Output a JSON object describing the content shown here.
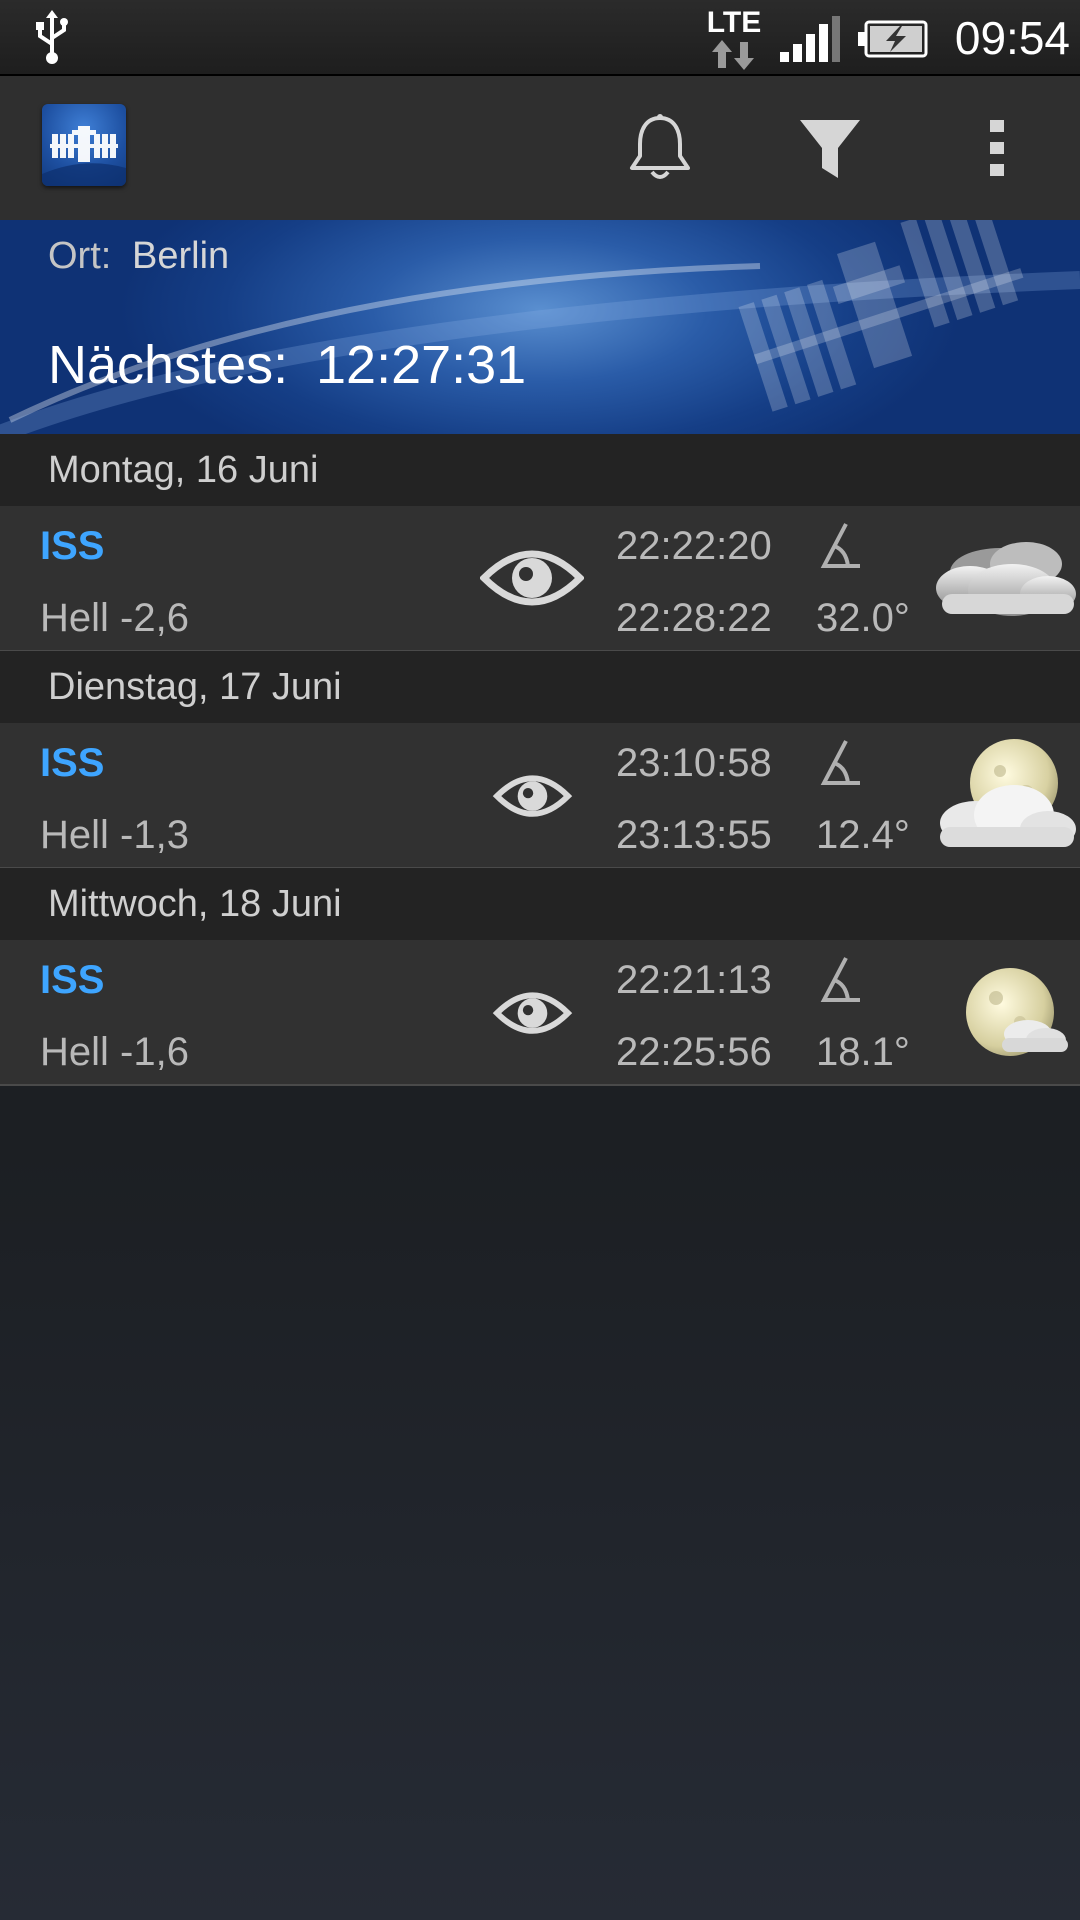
{
  "status_bar": {
    "network_label": "LTE",
    "clock": "09:54",
    "icons": [
      "usb-icon",
      "lte-data-icon",
      "signal-icon",
      "battery-charging-icon"
    ]
  },
  "action_bar": {
    "icons": [
      "app-logo-iss",
      "bell-icon",
      "filter-icon",
      "overflow-menu-icon"
    ]
  },
  "header": {
    "location_label": "Ort:",
    "location_value": "Berlin",
    "next_label": "Nächstes:",
    "next_value": "12:27:31"
  },
  "days": [
    {
      "label": "Montag, 16 Juni",
      "passes": [
        {
          "satellite": "ISS",
          "brightness": "Hell -2,6",
          "start": "22:22:20",
          "end": "22:28:22",
          "elevation": "32.0°",
          "visibility_icon": "eye-icon",
          "weather_icon": "cloudy-night-icon"
        }
      ]
    },
    {
      "label": "Dienstag, 17 Juni",
      "passes": [
        {
          "satellite": "ISS",
          "brightness": "Hell -1,3",
          "start": "23:10:58",
          "end": "23:13:55",
          "elevation": "12.4°",
          "visibility_icon": "eye-icon",
          "weather_icon": "moon-cloud-icon"
        }
      ]
    },
    {
      "label": "Mittwoch, 18 Juni",
      "passes": [
        {
          "satellite": "ISS",
          "brightness": "Hell -1,6",
          "start": "22:21:13",
          "end": "22:25:56",
          "elevation": "18.1°",
          "visibility_icon": "eye-icon",
          "weather_icon": "moon-small-cloud-icon"
        }
      ]
    }
  ],
  "colors": {
    "accent_blue": "#3ea5ff",
    "banner_blue": "#1d4fa0",
    "row_bg": "#313131",
    "header_bg": "#232323"
  }
}
